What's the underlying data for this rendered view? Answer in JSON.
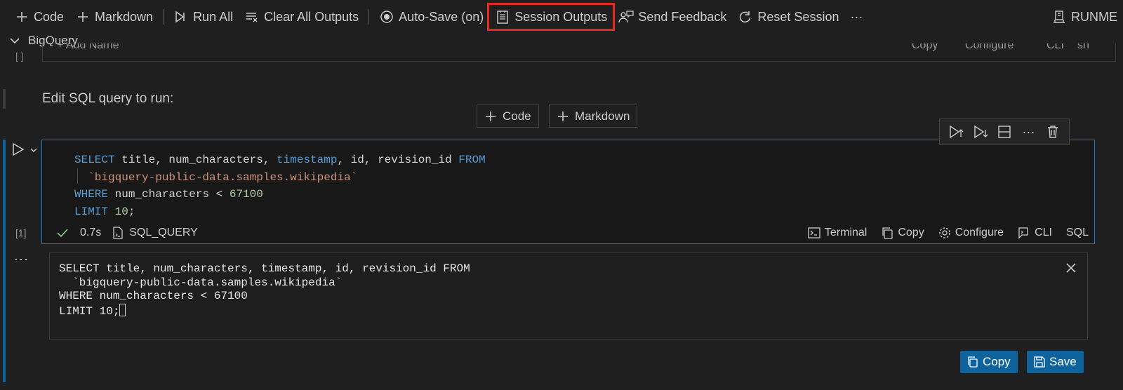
{
  "toolbar": {
    "add_code": "Code",
    "add_markdown": "Markdown",
    "run_all": "Run All",
    "clear_outputs": "Clear All Outputs",
    "auto_save": "Auto-Save (on)",
    "session_outputs": "Session Outputs",
    "send_feedback": "Send Feedback",
    "reset_session": "Reset Session",
    "more": "···",
    "runme": "RUNME",
    "highlight_color": "#e02b20"
  },
  "breadcrumb": {
    "label": "BigQuery"
  },
  "previous_cell": {
    "add_name": "+ Add Name",
    "copy": "Copy",
    "configure": "Configure",
    "cli": "CLI",
    "lang": "sh",
    "bracket": "[ ]"
  },
  "markdown_cell": {
    "text": "Edit SQL query to run:"
  },
  "insert": {
    "code": "Code",
    "markdown": "Markdown"
  },
  "code_cell": {
    "execution_count": "[1]",
    "lines": {
      "l1_kw1": "SELECT",
      "l1_mid": " title, num_characters, ",
      "l1_kw2": "timestamp",
      "l1_end": ", id, revision_id ",
      "l1_kw3": "FROM",
      "l2_str": "`bigquery-public-data.samples.wikipedia`",
      "l3_kw": "WHERE",
      "l3_mid": " num_characters < ",
      "l3_num": "67100",
      "l4_kw": "LIMIT",
      "l4_num": " 10",
      "l4_end": ";"
    },
    "status": {
      "duration": "0.7s",
      "name": "SQL_QUERY",
      "terminal": "Terminal",
      "copy": "Copy",
      "configure": "Configure",
      "cli": "CLI",
      "lang": "SQL"
    }
  },
  "output": {
    "dots": "···",
    "text": "SELECT title, num_characters, timestamp, id, revision_id FROM\n  `bigquery-public-data.samples.wikipedia`\nWHERE num_characters < 67100\nLIMIT 10;",
    "copy_button": "Copy",
    "save_button": "Save",
    "button_color": "#0e639c"
  }
}
